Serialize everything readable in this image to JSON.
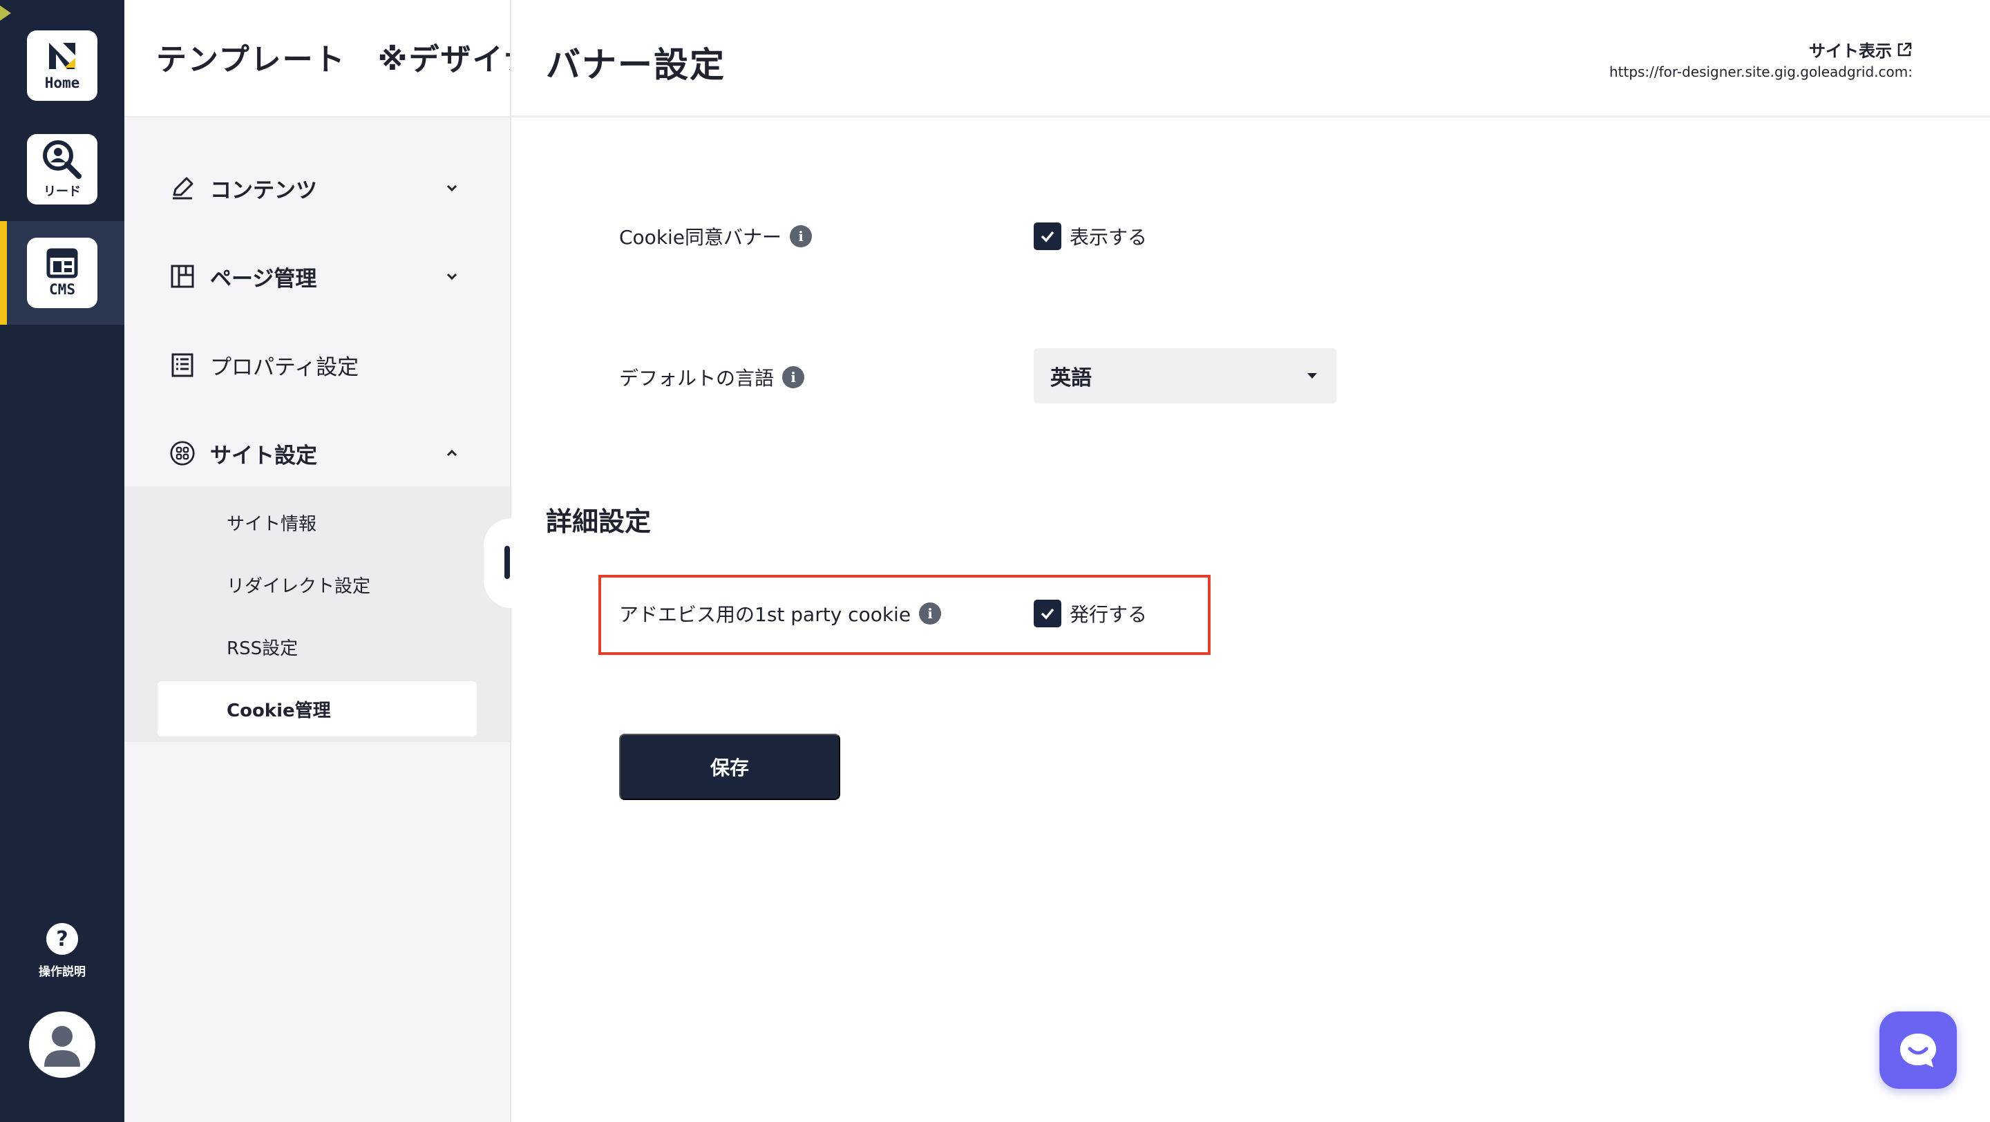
{
  "rail": {
    "home_label": "Home",
    "lead_label": "リード",
    "cms_label": "CMS",
    "help_label": "操作説明"
  },
  "sidebar": {
    "title": "テンプレート　※デザイナ",
    "nav": [
      {
        "label": "コンテンツ",
        "icon": "pen-icon",
        "expanded": false
      },
      {
        "label": "ページ管理",
        "icon": "layout-icon",
        "expanded": false
      },
      {
        "label": "プロパティ設定",
        "icon": "list-icon"
      },
      {
        "label": "サイト設定",
        "icon": "grid-circle-icon",
        "expanded": true
      }
    ],
    "sub_items": [
      "サイト情報",
      "リダイレクト設定",
      "RSS設定",
      "Cookie管理"
    ],
    "active_sub_item": "Cookie管理"
  },
  "header": {
    "page_title": "バナー設定",
    "site_link_label": "サイト表示",
    "site_url": "https://for-designer.site.gig.goleadgrid.com:"
  },
  "form": {
    "cookie_banner": {
      "label": "Cookie同意バナー",
      "checkbox_label": "表示する",
      "checked": true
    },
    "default_language": {
      "label": "デフォルトの言語",
      "value": "英語"
    },
    "advanced_section_title": "詳細設定",
    "first_party_cookie": {
      "label": "アドエビス用の1st party cookie",
      "checkbox_label": "発行する",
      "checked": true
    },
    "save_label": "保存"
  },
  "colors": {
    "rail_bg": "#1a243a",
    "accent": "#f2c417",
    "highlight_border": "#e3402a",
    "chat_bubble": "#6b63f2"
  }
}
